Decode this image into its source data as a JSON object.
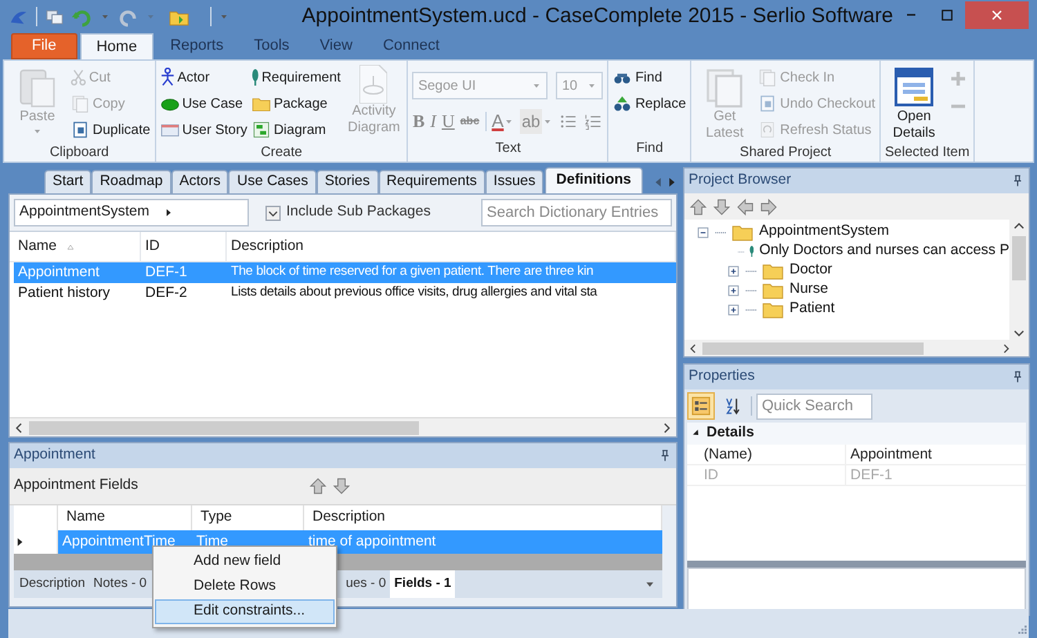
{
  "window": {
    "title": "AppointmentSystem.ucd - CaseComplete 2015 - Serlio Software"
  },
  "ribbon_tabs": [
    {
      "label": "File",
      "kind": "file",
      "selected": false
    },
    {
      "label": "Home",
      "kind": "tab",
      "selected": true
    },
    {
      "label": "Reports",
      "kind": "tab",
      "selected": false
    },
    {
      "label": "Tools",
      "kind": "tab",
      "selected": false
    },
    {
      "label": "View",
      "kind": "tab",
      "selected": false
    },
    {
      "label": "Connect",
      "kind": "tab",
      "selected": false
    }
  ],
  "ribbon_groups": [
    {
      "label": "Clipboard",
      "kind": "buttons",
      "items": [
        {
          "label": "Paste",
          "kind": "large",
          "disabled": true
        },
        {
          "label": "Cut",
          "kind": "small",
          "disabled": true
        },
        {
          "label": "Copy",
          "kind": "small",
          "disabled": true
        },
        {
          "label": "Duplicate",
          "kind": "small",
          "disabled": false
        }
      ]
    },
    {
      "label": "Create",
      "kind": "buttons",
      "items": [
        {
          "label": "Actor",
          "kind": "small",
          "disabled": false
        },
        {
          "label": "Use Case",
          "kind": "small",
          "disabled": false
        },
        {
          "label": "User Story",
          "kind": "small",
          "disabled": false
        },
        {
          "label": "Requirement",
          "kind": "small",
          "disabled": false
        },
        {
          "label": "Package",
          "kind": "small",
          "disabled": false
        },
        {
          "label": "Diagram",
          "kind": "small",
          "disabled": false
        },
        {
          "label": "Activity Diagram",
          "kind": "large",
          "disabled": true
        }
      ]
    },
    {
      "label": "Text",
      "kind": "text",
      "font": "Segoe UI",
      "size": "10",
      "format_buttons": [
        "B",
        "I",
        "U",
        "abc",
        "A",
        "ab"
      ]
    },
    {
      "label": "Find",
      "kind": "buttons",
      "items": [
        {
          "label": "Find",
          "kind": "small",
          "disabled": false
        },
        {
          "label": "Replace",
          "kind": "small",
          "disabled": false
        }
      ]
    },
    {
      "label": "Shared Project",
      "kind": "buttons",
      "items": [
        {
          "label": "Get Latest",
          "kind": "large",
          "disabled": true
        },
        {
          "label": "Check In",
          "kind": "small",
          "disabled": true
        },
        {
          "label": "Undo Checkout",
          "kind": "small",
          "disabled": true
        },
        {
          "label": "Refresh Status",
          "kind": "small",
          "disabled": true
        }
      ]
    },
    {
      "label": "Selected Item",
      "kind": "buttons",
      "items": [
        {
          "label": "Open Details",
          "kind": "large",
          "disabled": false
        },
        {
          "kind": "icon",
          "disabled": true
        },
        {
          "kind": "icon",
          "disabled": true
        }
      ]
    }
  ],
  "document_tabs": [
    {
      "label": "Start",
      "selected": false
    },
    {
      "label": "Roadmap",
      "selected": false
    },
    {
      "label": "Actors",
      "selected": false
    },
    {
      "label": "Use Cases",
      "selected": false
    },
    {
      "label": "Stories",
      "selected": false
    },
    {
      "label": "Requirements",
      "selected": false
    },
    {
      "label": "Issues",
      "selected": false
    },
    {
      "label": "Definitions",
      "selected": true
    }
  ],
  "definitions": {
    "package": "AppointmentSystem",
    "include_sub_packages": {
      "label": "Include Sub Packages",
      "checked": true
    },
    "search": {
      "placeholder": "Search Dictionary Entries"
    },
    "columns": [
      {
        "label": "Name",
        "sorted": true
      },
      {
        "label": "ID",
        "sorted": false
      },
      {
        "label": "Description",
        "sorted": false
      }
    ],
    "rows": [
      {
        "cells": [
          "Appointment",
          "DEF-1",
          "The block of time reserved for a given patient.  There are three kin"
        ],
        "selected": true
      },
      {
        "cells": [
          "Patient history",
          "DEF-2",
          "Lists details about previous office visits, drug allergies and vital sta"
        ],
        "selected": false
      }
    ]
  },
  "detail_panel": {
    "title": "Appointment",
    "fields_title": "Appointment Fields",
    "columns": [
      "Name",
      "Type",
      "Description"
    ],
    "rows": [
      {
        "cells": [
          "AppointmentTime",
          "Time",
          "time of appointment"
        ],
        "selected": true
      }
    ],
    "tabs": [
      {
        "label": "Description",
        "selected": false
      },
      {
        "label": "Notes - 0",
        "selected": false
      },
      {
        "label": "ues - 0",
        "selected": false
      },
      {
        "label": "Fields - 1",
        "selected": true
      }
    ]
  },
  "context_menu": {
    "items": [
      {
        "label": "Add new field",
        "selected": false
      },
      {
        "label": "Delete Rows",
        "selected": false
      },
      {
        "label": "Edit constraints...",
        "selected": true
      }
    ]
  },
  "project_browser": {
    "title": "Project Browser",
    "tree": [
      {
        "label": "AppointmentSystem",
        "kind": "package",
        "expanded": true,
        "children": [
          {
            "label": "Only Doctors and nurses can access P",
            "kind": "requirement"
          },
          {
            "label": "Doctor",
            "kind": "folder",
            "expanded": false
          },
          {
            "label": "Nurse",
            "kind": "folder",
            "expanded": false
          },
          {
            "label": "Patient",
            "kind": "folder",
            "expanded": false
          }
        ]
      }
    ]
  },
  "properties": {
    "title": "Properties",
    "view_buttons": [
      {
        "selected": true
      },
      {
        "selected": false
      }
    ],
    "search": {
      "placeholder": "Quick Search"
    },
    "categories": [
      {
        "label": "Details",
        "expanded": true,
        "rows": [
          {
            "name": "(Name)",
            "value": "Appointment",
            "disabled": false
          },
          {
            "name": "ID",
            "value": "DEF-1",
            "disabled": true
          }
        ]
      }
    ]
  }
}
